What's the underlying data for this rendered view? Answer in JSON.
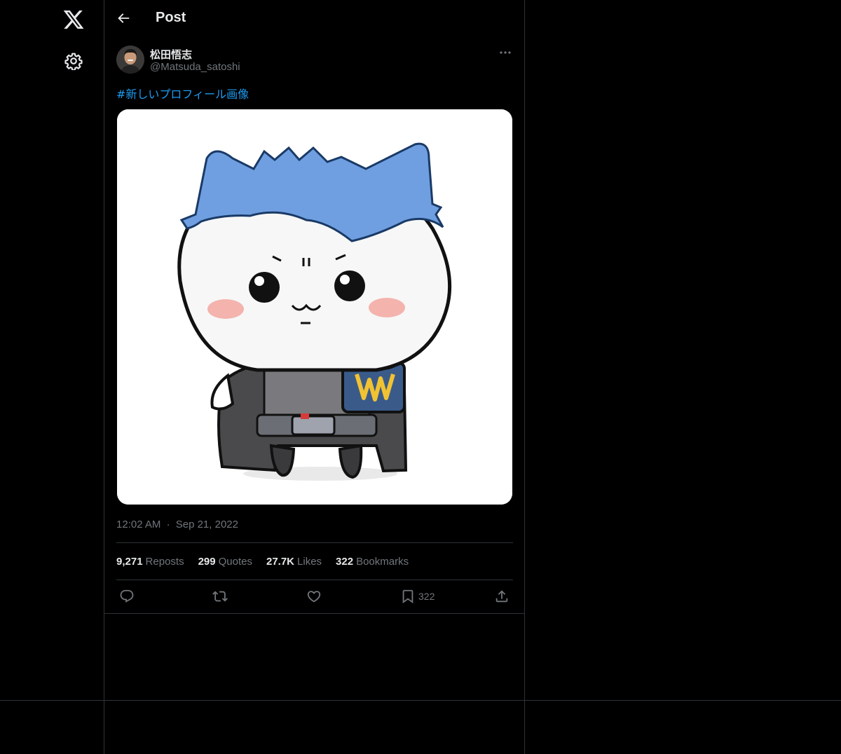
{
  "header": {
    "title": "Post"
  },
  "post": {
    "author_name": "松田悟志",
    "author_handle": "@Matsuda_satoshi",
    "text": "#新しいプロフィール画像",
    "timestamp_time": "12:02 AM",
    "timestamp_sep": "·",
    "timestamp_date": "Sep 21, 2022",
    "media_description_icon": "cat-character-illustration"
  },
  "stats": [
    {
      "value": "9,271",
      "label": "Reposts"
    },
    {
      "value": "299",
      "label": "Quotes"
    },
    {
      "value": "27.7K",
      "label": "Likes"
    },
    {
      "value": "322",
      "label": "Bookmarks"
    }
  ],
  "actions": {
    "bookmark_count": "322"
  },
  "colors": {
    "background": "#000000",
    "accent": "#1d9bf0",
    "muted": "#71767b",
    "border": "#2f3336"
  }
}
